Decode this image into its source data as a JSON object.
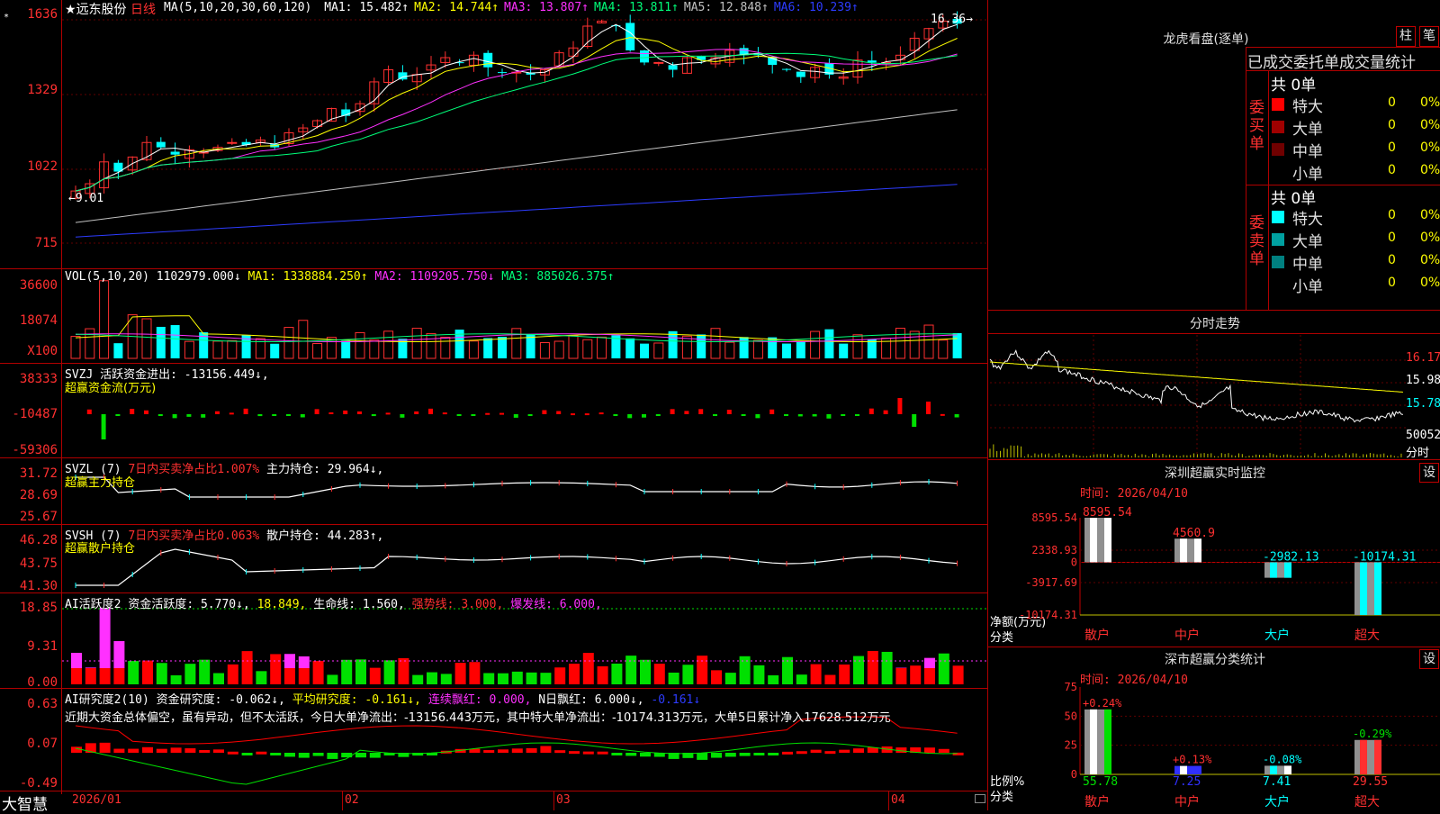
{
  "app": {
    "logo": "大智慧",
    "stock_name": "远东股份",
    "period": "日线",
    "ma_label": "MA(5,10,20,30,60,120)",
    "ma_values": [
      {
        "label": "MA1: 15.482↑",
        "color": "#ffffff"
      },
      {
        "label": "MA2: 14.744↑",
        "color": "#ffff00"
      },
      {
        "label": "MA3: 13.807↑",
        "color": "#ff30ff"
      },
      {
        "label": "MA4: 13.811↑",
        "color": "#00ff7a"
      },
      {
        "label": "MA5: 12.848↑",
        "color": "#c0c0c0"
      },
      {
        "label": "MA6: 10.239↑",
        "color": "#2d3cff"
      }
    ],
    "high_marker": "16.36",
    "low_marker": "9.01",
    "price_axis": [
      "1636",
      "1329",
      "1022",
      "715"
    ],
    "date_axis": [
      "2026/01",
      "02",
      "03",
      "04"
    ]
  },
  "vol": {
    "title": "VOL(5,10,20)",
    "value": "1102979.000↓",
    "ma1": "MA1: 1338884.250↑",
    "ma2": "MA2: 1109205.750↓",
    "ma3": "MA3: 885026.375↑",
    "axis": [
      "36600",
      "18074",
      "X100"
    ]
  },
  "svzj": {
    "title": "SVZJ",
    "desc": "活跃资金进出: -13156.449↓,",
    "subtitle": "超赢资金流(万元)",
    "axis": [
      "38333",
      "-10487",
      "-59306"
    ]
  },
  "svzl": {
    "title": "SVZL (7)",
    "desc1": "7日内买卖净占比1.007%",
    "desc2": "主力持仓: 29.964↓,",
    "subtitle": "超赢主力持仓",
    "axis": [
      "31.72",
      "28.69",
      "25.67"
    ]
  },
  "svsh": {
    "title": "SVSH (7)",
    "desc1": "7日内买卖净占比0.063%",
    "desc2": "散户持仓: 44.283↑,",
    "subtitle": "超赢散户持仓",
    "axis": [
      "46.28",
      "43.75",
      "41.30"
    ]
  },
  "ai1": {
    "title": "AI活跃度2",
    "v1": "资金活跃度: 5.770↓,",
    "v2": "18.849,",
    "v3": "生命线: 1.560,",
    "v4": "强势线: 3.000,",
    "v5": "爆发线: 6.000,",
    "axis": [
      "18.85",
      "9.31",
      "0.00"
    ]
  },
  "ai2": {
    "title": "AI研究度2(10)",
    "v1": "资金研究度: -0.062↓,",
    "v2": "平均研究度: -0.161↓,",
    "v3": "连续飘红: 0.000,",
    "v4": "N日飘红: 6.000↓,",
    "v5": "-0.161↓",
    "summary": "近期大资金总体偏空，虽有异动，但不太活跃，今日大单净流出：-13156.443万元，其中特大单净流出：-10174.313万元，大单5日累计净入17628.512万元",
    "axis": [
      "0.63",
      "0.07",
      "-0.49"
    ]
  },
  "dragon": {
    "title": "龙虎看盘(逐单)",
    "btn_bar": "柱",
    "btn_pen": "笔",
    "tabs": "已成交委托单成交量统计",
    "buy_label": "委买单",
    "sell_label": "委卖单",
    "buy_total": "共 0单",
    "sell_total": "共 0单",
    "buy_rows": [
      {
        "label": "特大",
        "value": "0",
        "pct": "0%",
        "color": "#ff0000"
      },
      {
        "label": "大单",
        "value": "0",
        "pct": "0%",
        "color": "#a00000"
      },
      {
        "label": "中单",
        "value": "0",
        "pct": "0%",
        "color": "#700000"
      },
      {
        "label": "小单",
        "value": "0",
        "pct": "0%",
        "color": ""
      }
    ],
    "sell_rows": [
      {
        "label": "特大",
        "value": "0",
        "pct": "0%",
        "color": "#00ffff"
      },
      {
        "label": "大单",
        "value": "0",
        "pct": "0%",
        "color": "#00a0a0"
      },
      {
        "label": "中单",
        "value": "0",
        "pct": "0%",
        "color": "#008080"
      },
      {
        "label": "小单",
        "value": "0",
        "pct": "0%",
        "color": ""
      }
    ]
  },
  "intraday": {
    "title": "分时走势",
    "axis": [
      "16.17",
      "15.98",
      "15.78",
      "50052",
      "分时"
    ]
  },
  "monitor": {
    "title": "深圳超赢实时监控",
    "btn": "设",
    "time": "时间: 2026/04/10",
    "ylabel": "净额(万元)",
    "xlabel": "分类",
    "axis": [
      "8595.54",
      "2338.93",
      "0",
      "-3917.69",
      "-10174.31"
    ]
  },
  "classify": {
    "title": "深市超赢分类统计",
    "btn": "设",
    "time": "时间: 2026/04/10",
    "ylabel": "比例%",
    "xlabel": "分类",
    "axis": [
      "75",
      "50",
      "25",
      "0"
    ]
  },
  "chart_data": [
    {
      "type": "bar",
      "title": "深圳超赢实时监控",
      "ylabel": "净额(万元)",
      "xlabel": "分类",
      "categories": [
        "散户",
        "中户",
        "大户",
        "超大"
      ],
      "values": [
        8595.54,
        4560.9,
        -2982.13,
        -10174.31
      ],
      "value_labels": [
        "8595.54",
        "4560.9",
        "-2982.13",
        "-10174.31"
      ],
      "ylim": [
        -10174.31,
        8595.54
      ]
    },
    {
      "type": "bar",
      "title": "深市超赢分类统计",
      "ylabel": "比例%",
      "xlabel": "分类",
      "categories": [
        "散户",
        "中户",
        "大户",
        "超大"
      ],
      "values": [
        55.78,
        7.25,
        7.41,
        29.55
      ],
      "value_labels": [
        "55.78",
        "7.25",
        "7.41",
        "29.55"
      ],
      "changes": [
        "+0.24%",
        "+0.13%",
        "-0.08%",
        "-0.29%"
      ],
      "ylim": [
        0,
        75
      ]
    }
  ]
}
